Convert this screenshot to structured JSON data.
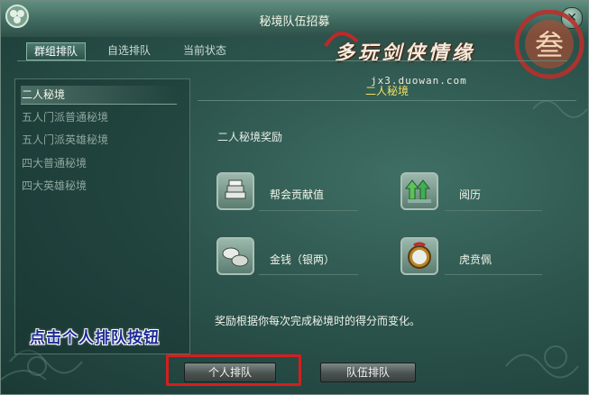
{
  "window": {
    "title": "秘境队伍招募"
  },
  "tabs": [
    {
      "label": "群组排队",
      "active": true
    },
    {
      "label": "自选排队",
      "active": false
    },
    {
      "label": "当前状态",
      "active": false
    }
  ],
  "dungeon_list": [
    {
      "label": "二人秘境",
      "selected": true
    },
    {
      "label": "五人门派普通秘境",
      "selected": false
    },
    {
      "label": "五人门派英雄秘境",
      "selected": false
    },
    {
      "label": "四大普通秘境",
      "selected": false
    },
    {
      "label": "四大英雄秘境",
      "selected": false
    }
  ],
  "detail": {
    "heading": "二人秘境",
    "rewards_title": "二人秘境奖励",
    "rewards": [
      {
        "label": "帮会贡献值",
        "icon": "silver-bars-icon"
      },
      {
        "label": "阅历",
        "icon": "green-arrows-icon"
      },
      {
        "label": "金钱（银两）",
        "icon": "silver-ingots-icon"
      },
      {
        "label": "虎贲佩",
        "icon": "jade-medallion-icon"
      }
    ],
    "note": "奖励根据你每次完成秘境时的得分而变化。"
  },
  "buttons": {
    "solo_queue": "个人排队",
    "team_queue": "队伍排队"
  },
  "instruction": "点击个人排队按钮",
  "watermark": {
    "brand": "多玩剑侠情缘叁",
    "url": "jx3.duowan.com"
  },
  "colors": {
    "heading": "#f0e060",
    "highlight": "#d51e1e",
    "instruction": "#1d2b95"
  }
}
